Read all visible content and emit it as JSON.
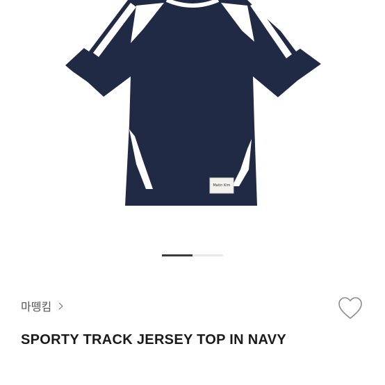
{
  "product": {
    "brand": "마뗑킴",
    "title": "SPORTY TRACK JERSEY TOP IN NAVY",
    "label_tag_text": "Matin Kim",
    "main_color": "#212a45",
    "trim_color": "#ffffff"
  },
  "gallery": {
    "current_index": 1,
    "progress_fraction": 0.5
  },
  "icons": {
    "brand_link": "chevron-right-icon",
    "wishlist": "heart-outline-icon"
  }
}
